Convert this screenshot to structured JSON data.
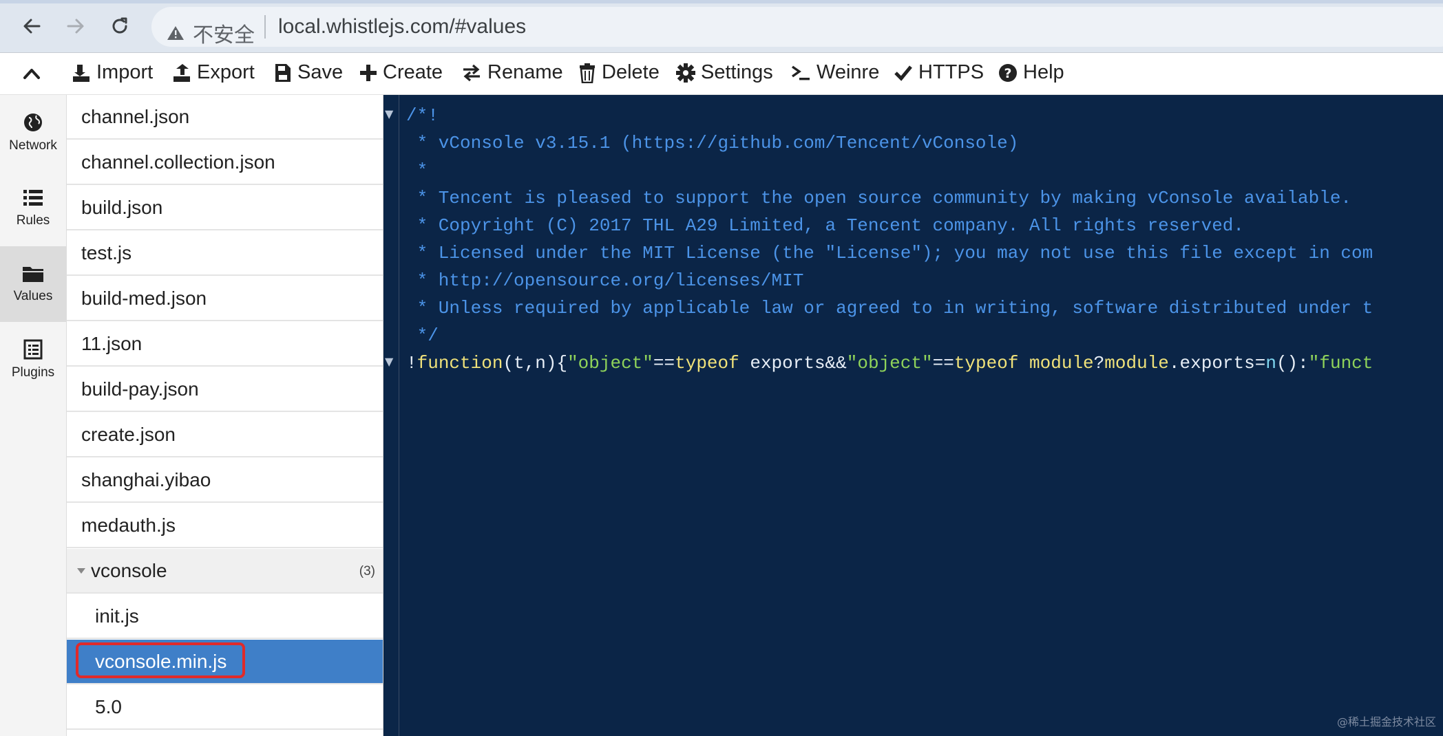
{
  "browser": {
    "security_label": "不安全",
    "url": "local.whistlejs.com/#values",
    "icons": [
      "back-arrow-icon",
      "forward-arrow-icon",
      "reload-icon",
      "warning-icon"
    ]
  },
  "toolbar": {
    "items": [
      {
        "label": "Import",
        "icon": "import-icon"
      },
      {
        "label": "Export",
        "icon": "export-icon"
      },
      {
        "label": "Save",
        "icon": "save-icon"
      },
      {
        "label": "Create",
        "icon": "plus-icon"
      },
      {
        "label": "Rename",
        "icon": "rename-icon"
      },
      {
        "label": "Delete",
        "icon": "trash-icon"
      },
      {
        "label": "Settings",
        "icon": "gear-icon"
      },
      {
        "label": "Weinre",
        "icon": "terminal-icon"
      },
      {
        "label": "HTTPS",
        "icon": "check-icon"
      },
      {
        "label": "Help",
        "icon": "question-circle-icon"
      }
    ]
  },
  "sidebar": {
    "items": [
      {
        "label": "Network",
        "icon": "globe-icon"
      },
      {
        "label": "Rules",
        "icon": "list-icon"
      },
      {
        "label": "Values",
        "icon": "folder-icon",
        "active": true
      },
      {
        "label": "Plugins",
        "icon": "plugin-icon"
      }
    ]
  },
  "files": {
    "items": [
      "channel.json",
      "channel.collection.json",
      "build.json",
      "test.js",
      "build-med.json",
      "11.json",
      "build-pay.json",
      "create.json",
      "shanghai.yibao",
      "medauth.js"
    ],
    "group": {
      "name": "vconsole",
      "count": "(3)"
    },
    "children": [
      "init.js",
      "vconsole.min.js",
      "5.0"
    ],
    "selected": "vconsole.min.js"
  },
  "editor": {
    "comment_lines": [
      "/*!",
      " * vConsole v3.15.1 (https://github.com/Tencent/vConsole)",
      " *",
      " * Tencent is pleased to support the open source community by making vConsole available.",
      " * Copyright (C) 2017 THL A29 Limited, a Tencent company. All rights reserved.",
      " * Licensed under the MIT License (the \"License\"); you may not use this file except in com",
      " * http://opensource.org/licenses/MIT",
      " * Unless required by applicable law or agreed to in writing, software distributed under t",
      " */"
    ],
    "code_tokens": [
      {
        "t": "!",
        "c": "plain"
      },
      {
        "t": "function",
        "c": "kw"
      },
      {
        "t": "(t,n){",
        "c": "plain"
      },
      {
        "t": "\"object\"",
        "c": "str"
      },
      {
        "t": "==",
        "c": "plain"
      },
      {
        "t": "typeof",
        "c": "kw"
      },
      {
        "t": " exports&&",
        "c": "plain"
      },
      {
        "t": "\"object\"",
        "c": "str"
      },
      {
        "t": "==",
        "c": "plain"
      },
      {
        "t": "typeof",
        "c": "kw"
      },
      {
        "t": " ",
        "c": "plain"
      },
      {
        "t": "module",
        "c": "kw"
      },
      {
        "t": "?",
        "c": "plain"
      },
      {
        "t": "module",
        "c": "kw"
      },
      {
        "t": ".exports=",
        "c": "plain"
      },
      {
        "t": "n",
        "c": "var"
      },
      {
        "t": "():",
        "c": "plain"
      },
      {
        "t": "\"funct",
        "c": "str"
      }
    ]
  },
  "watermark": "@稀土掘金技术社区",
  "colors": {
    "editor_bg": "#0b2547",
    "comment": "#4c94e8",
    "keyword": "#f0e27a",
    "string": "#8fd35a",
    "selected_row": "#3f7fc8",
    "highlight_border": "#e02a2a"
  }
}
